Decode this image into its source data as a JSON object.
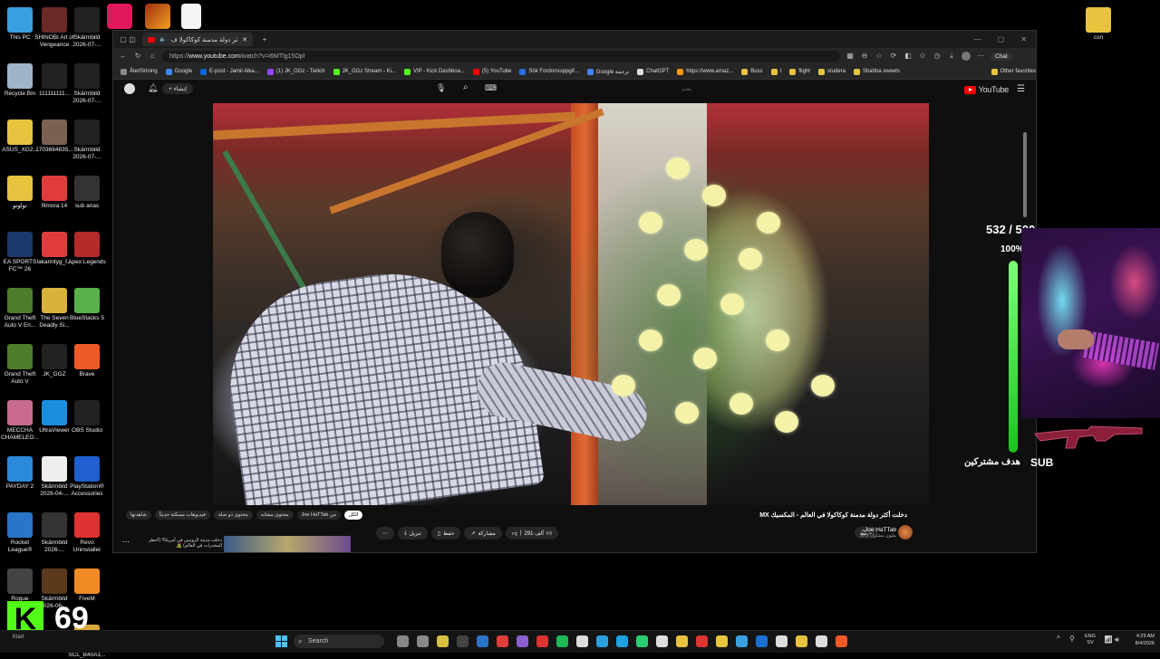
{
  "desktop": {
    "icons": [
      {
        "label": "This PC",
        "color": "#3aa0e0"
      },
      {
        "label": "Recycle Bin",
        "color": "#9fb4c8"
      },
      {
        "label": "ASUS_XG2...",
        "color": "#e8c340"
      },
      {
        "label": "تولوتو",
        "color": "#e8c340"
      },
      {
        "label": "EA SPORTS FC™ 26",
        "color": "#1b3a6b"
      },
      {
        "label": "Grand Theft Auto V En...",
        "color": "#4d7c2a"
      },
      {
        "label": "Grand Theft Auto V",
        "color": "#4d7c2a"
      },
      {
        "label": "MECCHA CHAMELEO...",
        "color": "#c86b8e"
      },
      {
        "label": "PAYDAY 2",
        "color": "#2b8ad9"
      },
      {
        "label": "Rocket League®",
        "color": "#2a74c9"
      },
      {
        "label": "Rogue Company",
        "color": "#444"
      },
      {
        "label": "SHINOBI Art of Vengeance",
        "color": "#6a2a2a"
      },
      {
        "label": "111111111...",
        "color": "#222"
      },
      {
        "label": "1703684835...",
        "color": "#7a6050"
      },
      {
        "label": "filmora 14",
        "color": "#e23b3b"
      },
      {
        "label": "lakarintyg_f...",
        "color": "#e23b3b"
      },
      {
        "label": "The Seven Deadly Si...",
        "color": "#d9b23a"
      },
      {
        "label": "JK_GGZ",
        "color": "#222"
      },
      {
        "label": "UltraViewer",
        "color": "#1a8fe0"
      },
      {
        "label": "Skärmbild 2026-04-...",
        "color": "#eee"
      },
      {
        "label": "Skärmbild 2026-...",
        "color": "#333"
      },
      {
        "label": "Skärmbild 2026-06-...",
        "color": "#5a3a1a"
      },
      {
        "label": "Skärmbild 2026-07-...",
        "color": "#222"
      },
      {
        "label": "Skärmbild 2026-07-...",
        "color": "#222"
      },
      {
        "label": "Skärmbild 2026-07-...",
        "color": "#222"
      },
      {
        "label": "sub anas",
        "color": "#333"
      },
      {
        "label": "Apex Legends",
        "color": "#b52a2a"
      },
      {
        "label": "BlueStacks 5",
        "color": "#5ab04a"
      },
      {
        "label": "Brave",
        "color": "#f05a28"
      },
      {
        "label": "OBS Studio",
        "color": "#222"
      },
      {
        "label": "PlayStation® Accessories",
        "color": "#1f5fd0"
      },
      {
        "label": "Revo Uninstaller",
        "color": "#d33"
      },
      {
        "label": "FiveM",
        "color": "#f08a24"
      },
      {
        "label": "SCL_B40A1...",
        "color": "#d9a83a"
      }
    ],
    "right_icon": {
      "label": "csn",
      "color": "#e8c340"
    }
  },
  "browser": {
    "tab_title": "دخلت أكثر دولة مدمنة كوكاكولا ف",
    "url_prefix": "https://",
    "url_domain": "www.youtube.com",
    "url_rest": "/watch?v=i6MTlg15Opl",
    "chat_label": "Chat",
    "favorites": [
      {
        "label": "Återförining",
        "color": "#888"
      },
      {
        "label": "Google",
        "color": "#4285f4"
      },
      {
        "label": "E-post - Jamil Alka...",
        "color": "#0a64d8"
      },
      {
        "label": "(1) JK_GGz - Twitch",
        "color": "#9146ff"
      },
      {
        "label": "JK_GGz Stream - Ki...",
        "color": "#53fc18"
      },
      {
        "label": "VIP - Kick Dashboa...",
        "color": "#53fc18"
      },
      {
        "label": "(5) YouTube",
        "color": "#ff0000"
      },
      {
        "label": "Sök Fordonsuppgif...",
        "color": "#2a6cd8"
      },
      {
        "label": "Google ترجمة",
        "color": "#4285f4"
      },
      {
        "label": "ChatGPT",
        "color": "#ddd"
      },
      {
        "label": "https://www.amaz...",
        "color": "#ff9900"
      },
      {
        "label": "Buss",
        "color": "#e8c340"
      },
      {
        "label": "t",
        "color": "#e8c340"
      },
      {
        "label": "flight",
        "color": "#e8c340"
      },
      {
        "label": "studera",
        "color": "#e8c340"
      },
      {
        "label": "Shahba sweets",
        "color": "#e8c340"
      },
      {
        "label": "Other favorites",
        "color": "#e8c340"
      }
    ]
  },
  "youtube": {
    "create_label": "إنشاء",
    "search_placeholder": "بحث",
    "logo_text": "YouTube",
    "video_title": "دخلت أكثر دولة مدمنة كوكاكولا في العالم - المكسيك MX",
    "channel_name": "Joe HaTTab",
    "channel_subs": "20.9 مليون مشترك",
    "like_count": "291 ألف",
    "share_label": "مشاركة",
    "save_label": "حفظ",
    "download_label": "تنزيل",
    "chips": [
      "الكل",
      "من Joe HaTTab",
      "محتوى مشابه",
      "محتوى ذو صلة",
      "فيديوهات مسكتة حديثاً",
      "شاهدتها"
    ],
    "rec_title": "دخلت مدينة الزومبي في أمريكا!! (أخطر المخدرات في العالم) 🧟"
  },
  "overlay": {
    "sub_count": "532 / 500",
    "sub_percent": "100%",
    "progress_fraction": 1.0,
    "goal_text": "هدف مشتركين",
    "goal_tag": "SUB",
    "kick_letter": "K",
    "kick_count": "69",
    "kick_sub": "Klart"
  },
  "taskbar": {
    "search_label": "Search",
    "lang": "ENG",
    "lang2": "SV",
    "time": "4:29 AM",
    "date": "8/4/2026",
    "apps": [
      "#888",
      "#888",
      "#d9c040",
      "#444",
      "#2a74c9",
      "#e23b3b",
      "#8a5fd0",
      "#d33",
      "#1db954",
      "#ddd",
      "#2aa0e0",
      "#1fa0e0",
      "#2ad070",
      "#ddd",
      "#e8c340",
      "#d33",
      "#e8c340",
      "#3aa0e0",
      "#1b6fd0",
      "#ddd",
      "#e8c340",
      "#ddd",
      "#f05a28"
    ]
  },
  "colors": {
    "accent": "#ff0000",
    "progress": "#19c41e",
    "kick": "#53fc18"
  }
}
